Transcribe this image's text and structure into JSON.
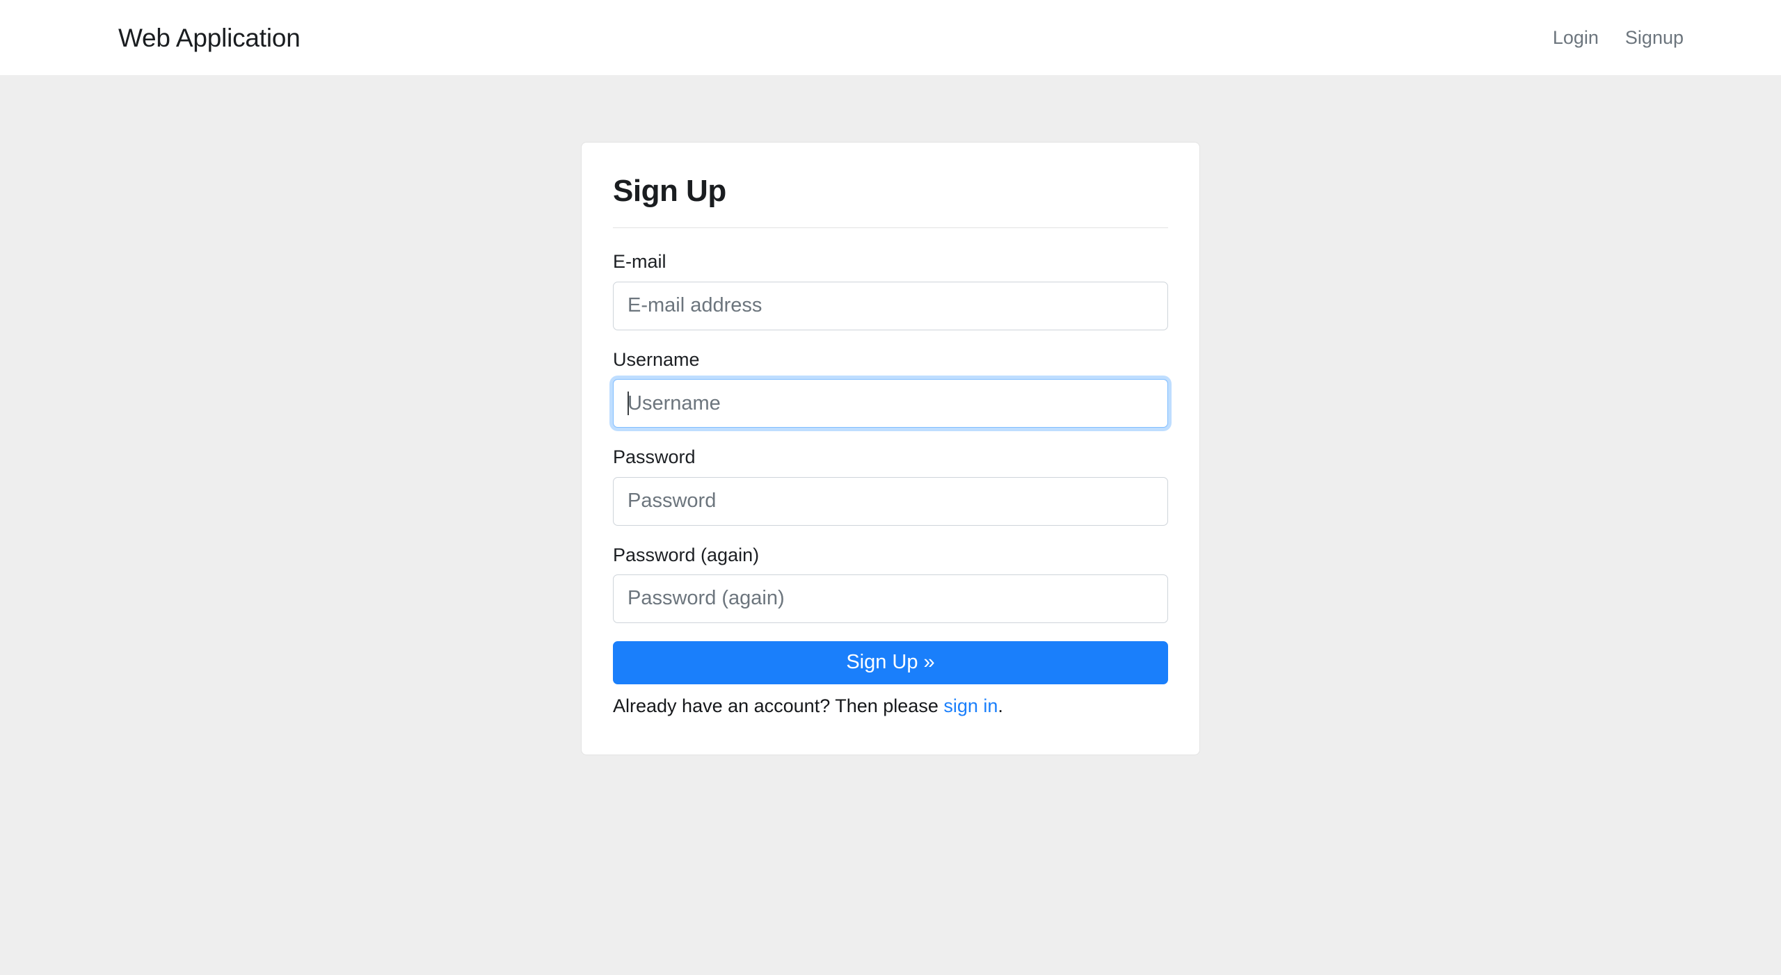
{
  "header": {
    "brand": "Web Application",
    "nav": [
      {
        "label": "Login",
        "name": "nav-link-login"
      },
      {
        "label": "Signup",
        "name": "nav-link-signup"
      }
    ]
  },
  "card": {
    "title": "Sign Up",
    "fields": [
      {
        "label": "E-mail",
        "placeholder": "E-mail address",
        "value": "",
        "type": "email",
        "focused": false
      },
      {
        "label": "Username",
        "placeholder": "Username",
        "value": "",
        "type": "text",
        "focused": true
      },
      {
        "label": "Password",
        "placeholder": "Password",
        "value": "",
        "type": "password",
        "focused": false
      },
      {
        "label": "Password (again)",
        "placeholder": "Password (again)",
        "value": "",
        "type": "password",
        "focused": false
      }
    ],
    "submit_label": "Sign Up »",
    "signin_prompt_before": "Already have an account? Then please ",
    "signin_link": "sign in",
    "signin_prompt_after": "."
  },
  "colors": {
    "primary": "#1a7ffb",
    "link": "#1a7ffb",
    "page_background": "#eeeeee",
    "card_background": "#ffffff",
    "nav_link": "#6c757d",
    "input_border": "#ced4da",
    "input_focus_border": "#80bdff",
    "placeholder": "#6c757d",
    "text": "#1a1d20"
  }
}
